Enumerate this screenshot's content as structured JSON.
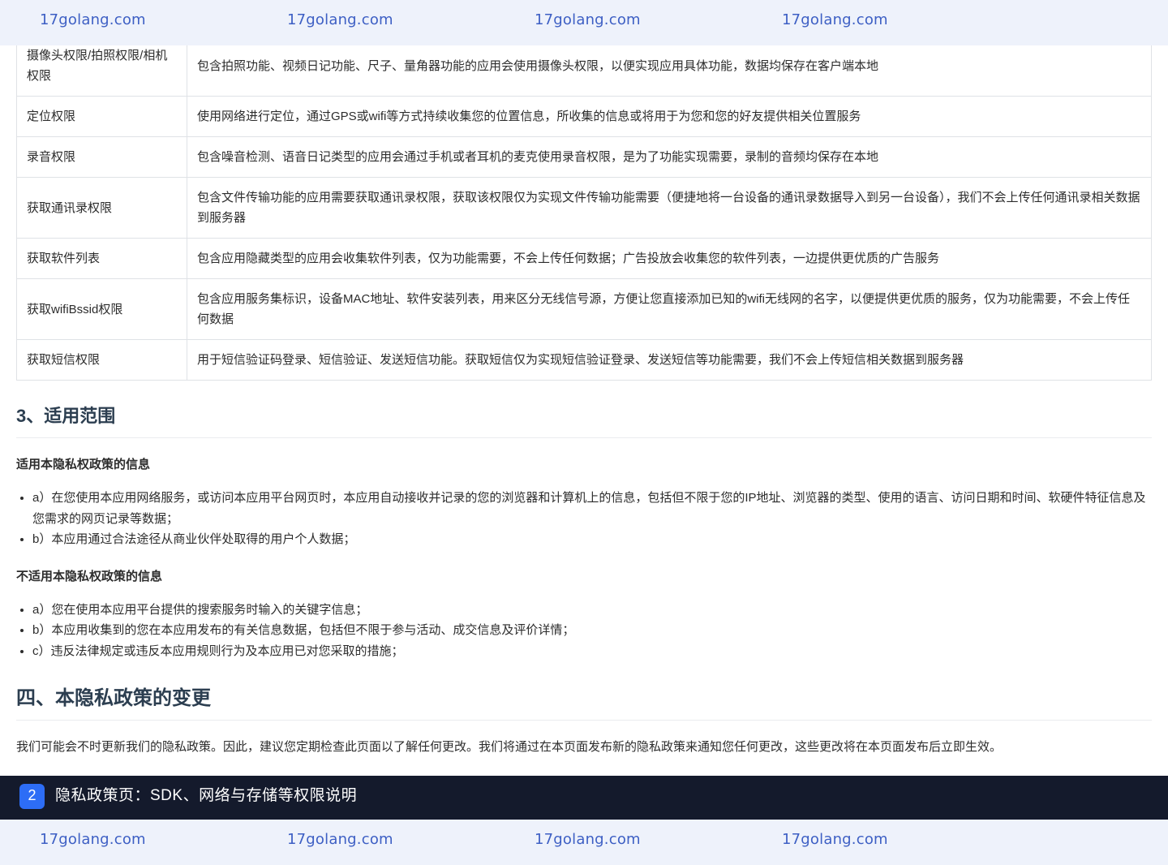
{
  "watermark": {
    "text": [
      "17golang.com",
      "17golang.com",
      "17golang.com",
      "17golang.com"
    ]
  },
  "permissions_table": {
    "rows": [
      {
        "name": "摄像头权限/拍照权限/相机权限",
        "desc": "包含拍照功能、视频日记功能、尺子、量角器功能的应用会使用摄像头权限，以便实现应用具体功能，数据均保存在客户端本地"
      },
      {
        "name": "定位权限",
        "desc": "使用网络进行定位，通过GPS或wifi等方式持续收集您的位置信息，所收集的信息或将用于为您和您的好友提供相关位置服务"
      },
      {
        "name": "录音权限",
        "desc": "包含噪音检测、语音日记类型的应用会通过手机或者耳机的麦克使用录音权限，是为了功能实现需要，录制的音频均保存在本地"
      },
      {
        "name": "获取通讯录权限",
        "desc": "包含文件传输功能的应用需要获取通讯录权限，获取该权限仅为实现文件传输功能需要（便捷地将一台设备的通讯录数据导入到另一台设备），我们不会上传任何通讯录相关数据到服务器"
      },
      {
        "name": "获取软件列表",
        "desc": "包含应用隐藏类型的应用会收集软件列表，仅为功能需要，不会上传任何数据；广告投放会收集您的软件列表，一边提供更优质的广告服务"
      },
      {
        "name": "获取wifiBssid权限",
        "desc": "包含应用服务集标识，设备MAC地址、软件安装列表，用来区分无线信号源，方便让您直接添加已知的wifi无线网的名字，以便提供更优质的服务，仅为功能需要，不会上传任何数据"
      },
      {
        "name": "获取短信权限",
        "desc": "用于短信验证码登录、短信验证、发送短信功能。获取短信仅为实现短信验证登录、发送短信等功能需要，我们不会上传短信相关数据到服务器"
      }
    ]
  },
  "section3": {
    "heading": "3、适用范围",
    "applicable_title": "适用本隐私权政策的信息",
    "applicable_items": [
      "a）在您使用本应用网络服务，或访问本应用平台网页时，本应用自动接收并记录的您的浏览器和计算机上的信息，包括但不限于您的IP地址、浏览器的类型、使用的语言、访问日期和时间、软硬件特征信息及您需求的网页记录等数据；",
      "b）本应用通过合法途径从商业伙伴处取得的用户个人数据；"
    ],
    "not_applicable_title": "不适用本隐私权政策的信息",
    "not_applicable_items": [
      "a）您在使用本应用平台提供的搜索服务时输入的关键字信息；",
      "b）本应用收集到的您在本应用发布的有关信息数据，包括但不限于参与活动、成交信息及评价详情；",
      "c）违反法律规定或违反本应用规则行为及本应用已对您采取的措施；"
    ]
  },
  "section4": {
    "heading": "四、本隐私政策的变更",
    "body": "我们可能会不时更新我们的隐私政策。因此，建议您定期检查此页面以了解任何更改。我们将通过在本页面发布新的隐私政策来通知您任何更改，这些更改将在本页面发布后立即生效。"
  },
  "caption": {
    "number": "2",
    "title": "隐私政策页：SDK、网络与存储等权限说明"
  }
}
